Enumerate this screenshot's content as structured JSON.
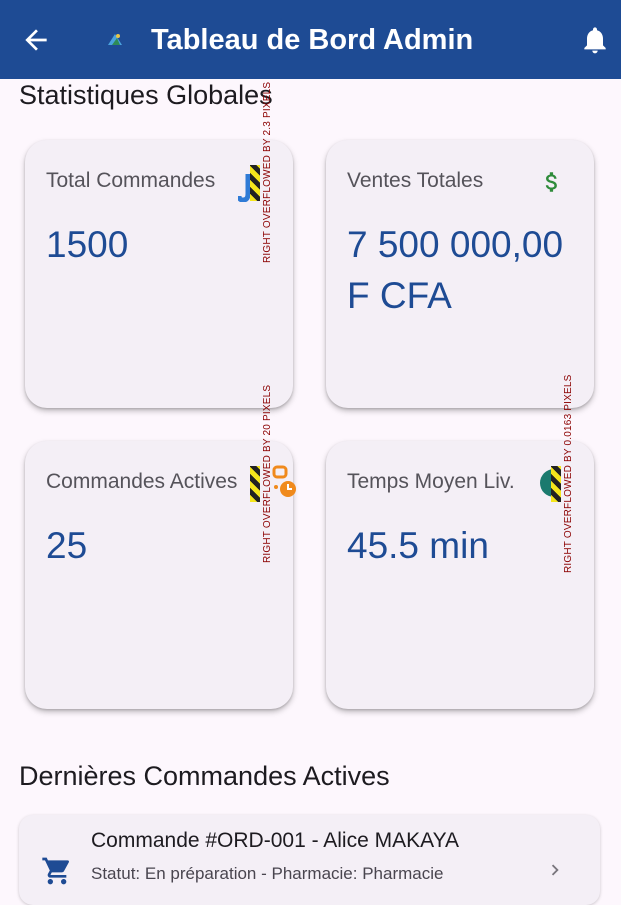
{
  "appbar": {
    "title": "Tableau de Bord Admin",
    "back_icon": "arrow-back-icon",
    "logo_icon": "app-logo-icon",
    "notification_icon": "bell-icon",
    "background": "#1e4b94"
  },
  "stats": {
    "section_title": "Statistiques Globales",
    "cards": [
      {
        "label": "Total Commandes",
        "value": "1500",
        "icon": "receipt-icon",
        "icon_color": "#2f7bd6",
        "overflow_text": "RIGHT OVERFLOWED BY 2.3 PIXELS"
      },
      {
        "label": "Ventes Totales",
        "value": "7 500 000,00 F CFA",
        "icon": "dollar-icon",
        "icon_color": "#2e8b3a"
      },
      {
        "label": "Commandes Actives",
        "value": "25",
        "icon": "delivery-timer-icon",
        "icon_color": "#f08a1c",
        "overflow_text": "RIGHT OVERFLOWED BY 20 PIXELS"
      },
      {
        "label": "Temps Moyen Liv.",
        "value": "45.5 min",
        "icon": "clock-icon",
        "icon_color": "#1b7a6e",
        "overflow_text": "RIGHT OVERFLOWED BY 0.0163 PIXELS"
      }
    ],
    "value_color": "#1e4b94"
  },
  "orders": {
    "section_title": "Dernières Commandes Actives",
    "items": [
      {
        "title": "Commande #ORD-001 - Alice MAKAYA",
        "subtitle": "Statut: En préparation - Pharmacie: Pharmacie",
        "icon": "shopping-cart-icon",
        "trailing_icon": "chevron-right-icon"
      }
    ]
  }
}
